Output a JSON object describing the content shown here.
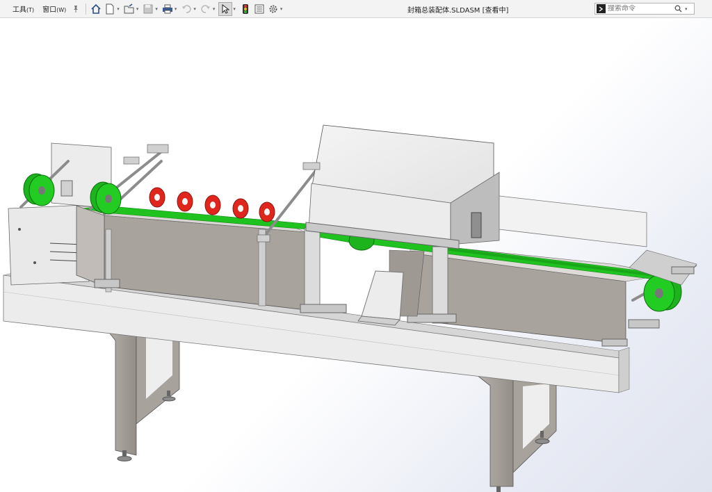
{
  "menu": {
    "tools": "工具",
    "tools_mn": "(T)",
    "window": "窗口",
    "window_mn": "(W)"
  },
  "document": {
    "title": "封箱总装配体.SLDASM [查看中]"
  },
  "search": {
    "placeholder": "搜索命令"
  },
  "colors": {
    "belt_green": "#1fc21f",
    "roller_red": "#e0261c",
    "frame_gray": "#a9a39e",
    "panel_light": "#ececec"
  },
  "icons": {
    "toolbar": [
      "home-icon",
      "new-document-icon",
      "open-icon",
      "save-icon",
      "print-icon",
      "undo-icon",
      "redo-icon",
      "select-arrow-icon",
      "traffic-light-icon",
      "file-properties-icon",
      "options-gear-icon"
    ],
    "view": [
      "zoom-to-fit-icon",
      "zoom-area-icon",
      "previous-view-icon",
      "section-view-icon",
      "view-orientation-icon",
      "display-style-icon",
      "hide-show-icon",
      "edit-appearance-icon",
      "apply-scene-icon",
      "view-settings-icon"
    ]
  }
}
